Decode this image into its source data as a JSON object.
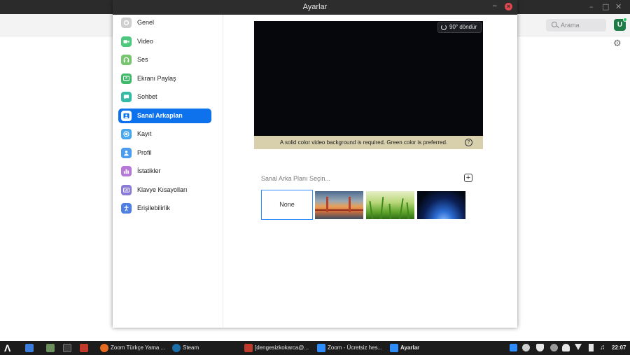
{
  "background_app": {
    "search_placeholder": "Arama",
    "avatar_initial": "U"
  },
  "dialog": {
    "title": "Ayarlar",
    "minimize_glyph": "–",
    "close_glyph": "×"
  },
  "sidebar": {
    "items": [
      {
        "label": "Genel",
        "icon": "gear-icon",
        "color": "#cfcfcf"
      },
      {
        "label": "Video",
        "icon": "video-camera-icon",
        "color": "#4cc77e"
      },
      {
        "label": "Ses",
        "icon": "headphones-icon",
        "color": "#78c56f"
      },
      {
        "label": "Ekranı Paylaş",
        "icon": "share-screen-icon",
        "color": "#3fba6a"
      },
      {
        "label": "Sohbet",
        "icon": "chat-icon",
        "color": "#34bba8"
      },
      {
        "label": "Sanal Arkaplan",
        "icon": "virtual-background-icon",
        "color": "#0e72ed",
        "active": true
      },
      {
        "label": "Kayıt",
        "icon": "record-icon",
        "color": "#47a6f0"
      },
      {
        "label": "Profil",
        "icon": "profile-icon",
        "color": "#4a9cf0"
      },
      {
        "label": "İstatikler",
        "icon": "statistics-icon",
        "color": "#b679d8"
      },
      {
        "label": "Klavye Kısayolları",
        "icon": "keyboard-icon",
        "color": "#8a7bd6"
      },
      {
        "label": "Erişilebilirlik",
        "icon": "accessibility-icon",
        "color": "#4f7fe0"
      }
    ]
  },
  "content": {
    "rotate_label": "90° döndür",
    "notice": "A solid color video background is required. Green color is preferred.",
    "help_glyph": "?",
    "choose_label": "Sanal Arka Planı Seçin...",
    "add_glyph": "+",
    "backgrounds": [
      {
        "label": "None",
        "selected": true
      },
      {
        "label": "",
        "image": "golden-gate-bridge"
      },
      {
        "label": "",
        "image": "grass"
      },
      {
        "label": "",
        "image": "earth-from-space"
      }
    ]
  },
  "taskbar": {
    "items": [
      {
        "label": "Zoom Türkçe Yama ...",
        "icon": "firefox-icon"
      },
      {
        "label": "Steam",
        "icon": "steam-icon"
      },
      {
        "label": "[dengesizkokarca@...",
        "icon": "app-icon"
      },
      {
        "label": "Zoom - Ücretsiz hes...",
        "icon": "zoom-icon"
      },
      {
        "label": "Ayarlar",
        "icon": "zoom-icon",
        "active": true
      }
    ],
    "clock": "22:07"
  }
}
